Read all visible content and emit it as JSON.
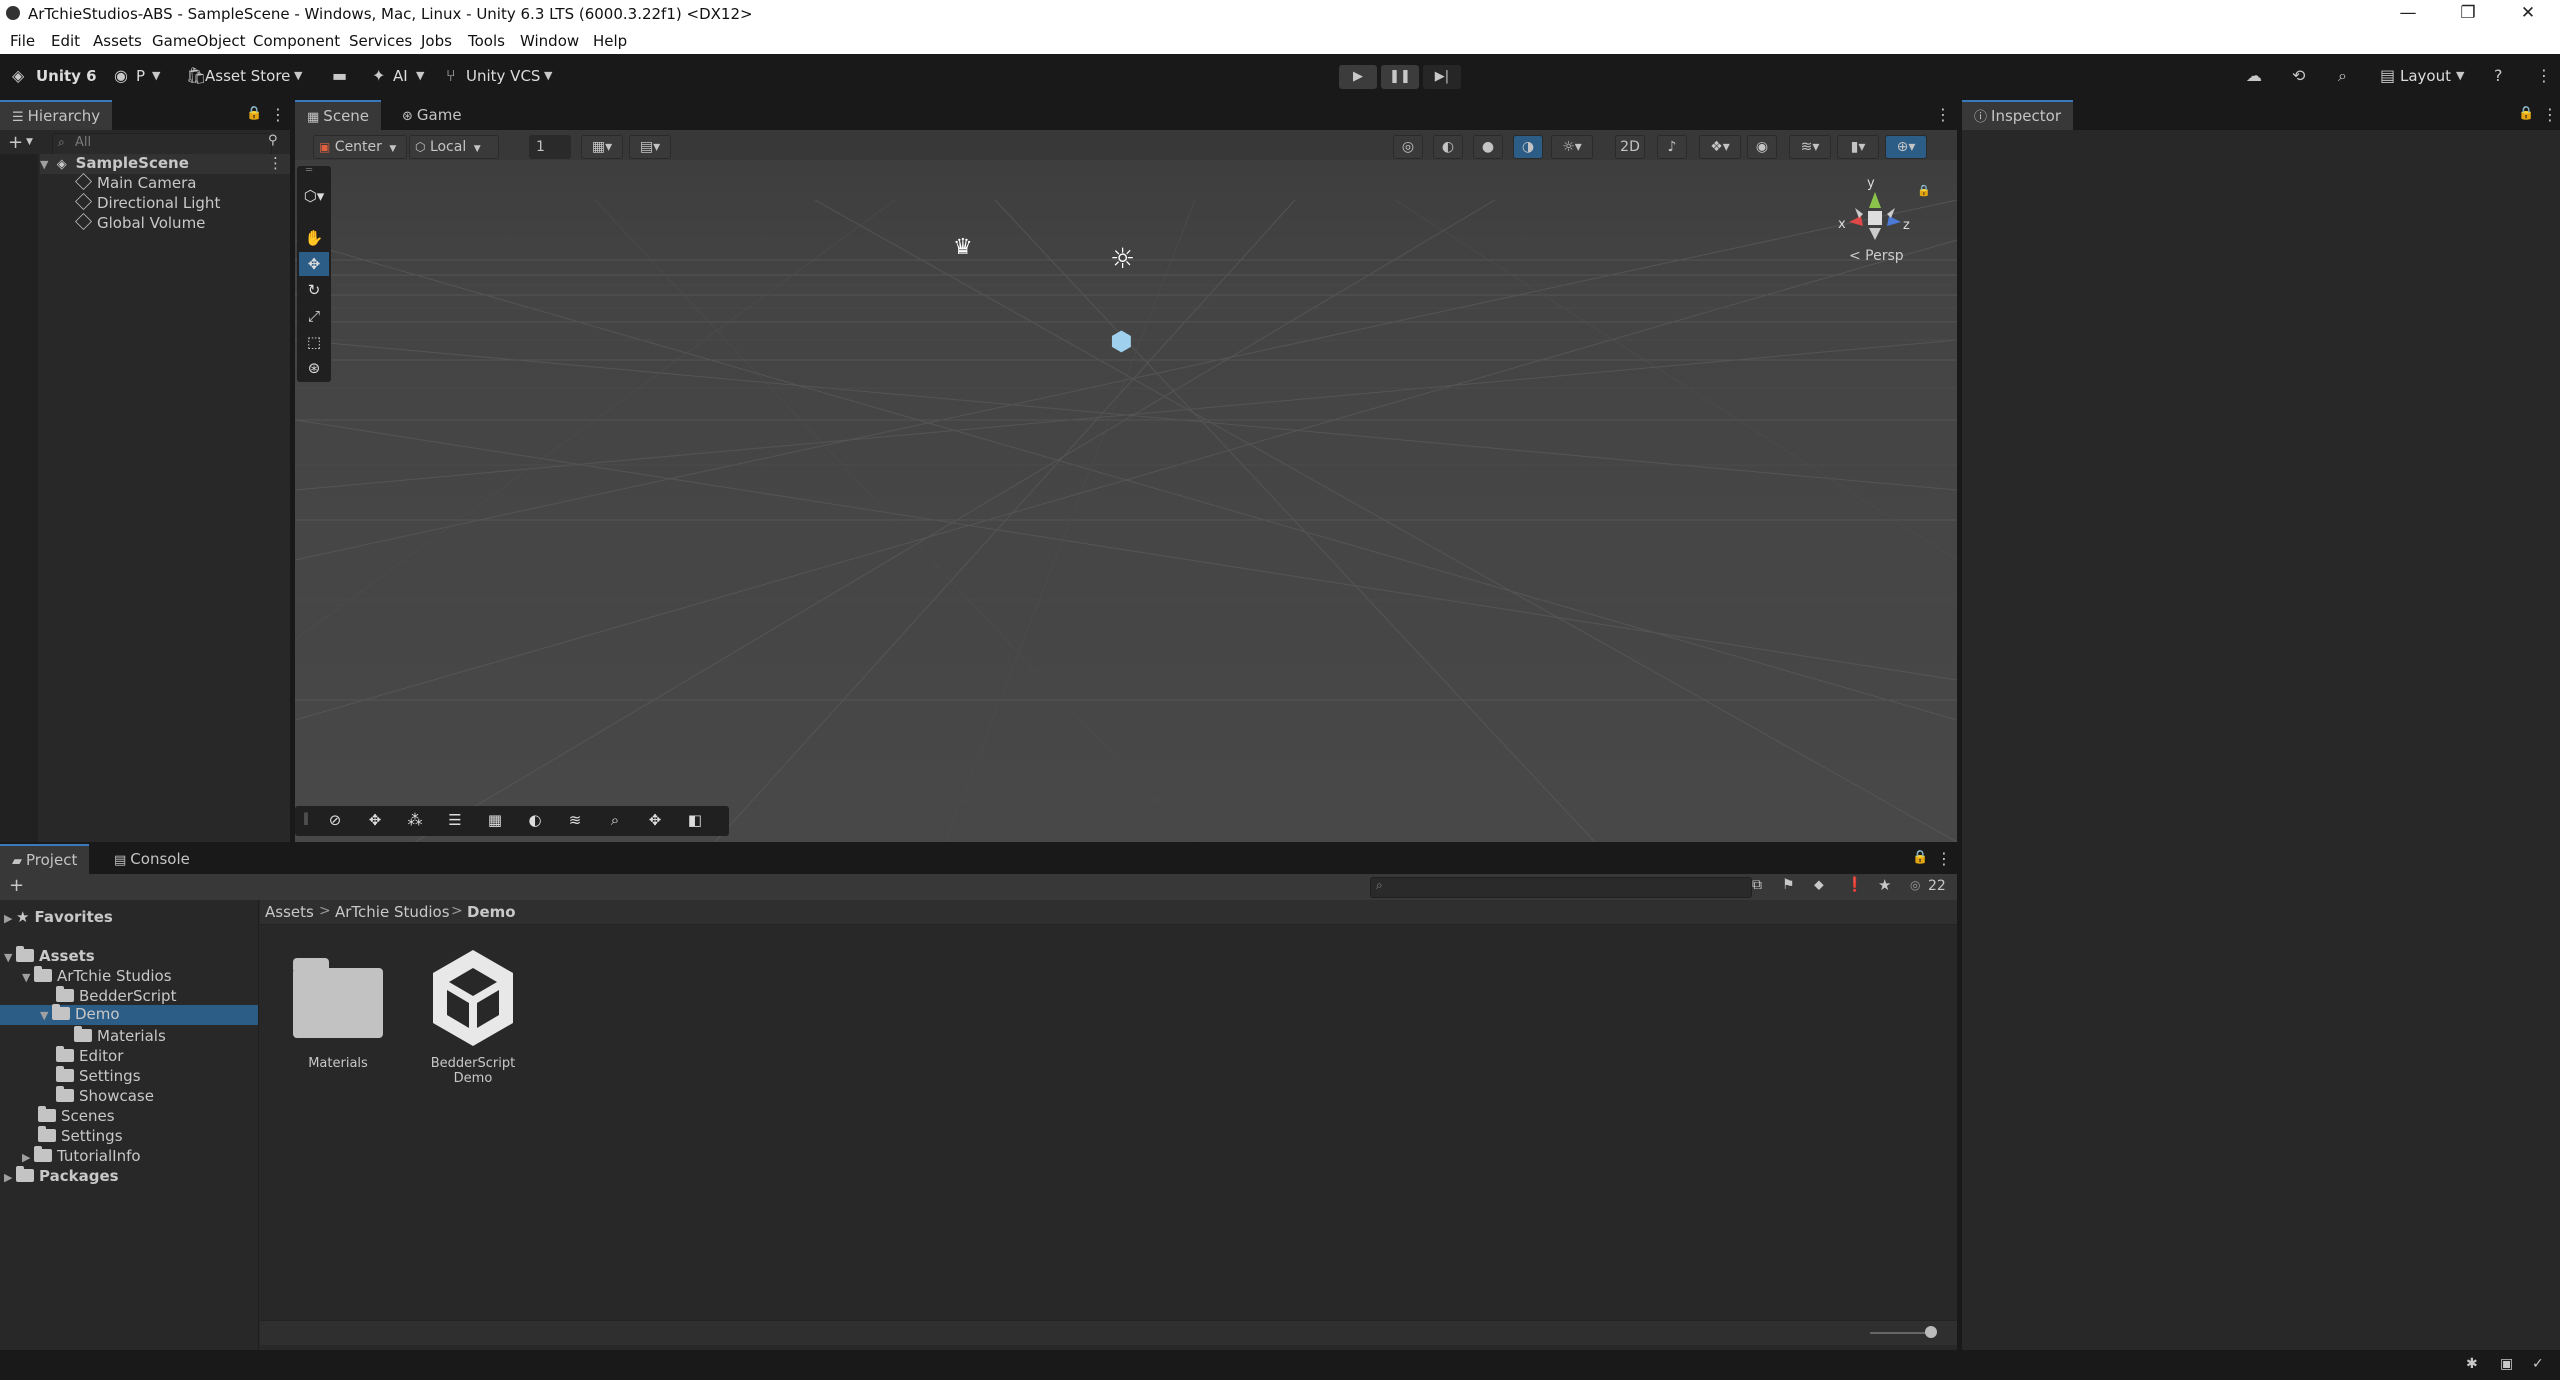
{
  "window": {
    "title": "ArTchieStudios-ABS - SampleScene - Windows, Mac, Linux - Unity 6.3 LTS (6000.3.22f1) <DX12>",
    "minimize": "—",
    "maximize": "❐",
    "close": "✕"
  },
  "menu": [
    "File",
    "Edit",
    "Assets",
    "GameObject",
    "Component",
    "Services",
    "Jobs",
    "Tools",
    "Window",
    "Help"
  ],
  "toolbar": {
    "unity_label": "Unity 6",
    "account_label": "P",
    "asset_store_label": "Asset Store",
    "ai_label": "AI",
    "vcs_label": "Unity VCS",
    "layout_label": "Layout",
    "play": "▶",
    "pause": "❚❚",
    "step": "▶|"
  },
  "hierarchy": {
    "tab": "Hierarchy",
    "search_placeholder": "All",
    "scene": "SampleScene",
    "items": [
      "Main Camera",
      "Directional Light",
      "Global Volume"
    ]
  },
  "scene_view": {
    "tab_scene": "Scene",
    "tab_game": "Game",
    "pivot": "Center",
    "space": "Local",
    "grid_size": "1",
    "persp_label": "< Persp",
    "gizmo_y": "y",
    "gizmo_x": "x",
    "gizmo_z": "z"
  },
  "inspector": {
    "tab": "Inspector"
  },
  "project": {
    "tab_project": "Project",
    "tab_console": "Console",
    "favorites": "Favorites",
    "tree": {
      "assets": "Assets",
      "artchie": "ArTchie Studios",
      "bedderscript": "BedderScript",
      "demo": "Demo",
      "materials": "Materials",
      "editor": "Editor",
      "settings_sub": "Settings",
      "showcase": "Showcase",
      "scenes": "Scenes",
      "settings": "Settings",
      "tutorialinfo": "TutorialInfo",
      "packages": "Packages"
    },
    "breadcrumb": [
      "Assets",
      "ArTchie Studios",
      "Demo"
    ],
    "items": [
      "Materials",
      "BedderScript Demo"
    ],
    "hidden_count": "22"
  },
  "colors": {
    "accent": "#2c5d87",
    "tab_highlight": "#3a79bb",
    "panel_bg": "#282828",
    "scene_bg": "#464646"
  }
}
